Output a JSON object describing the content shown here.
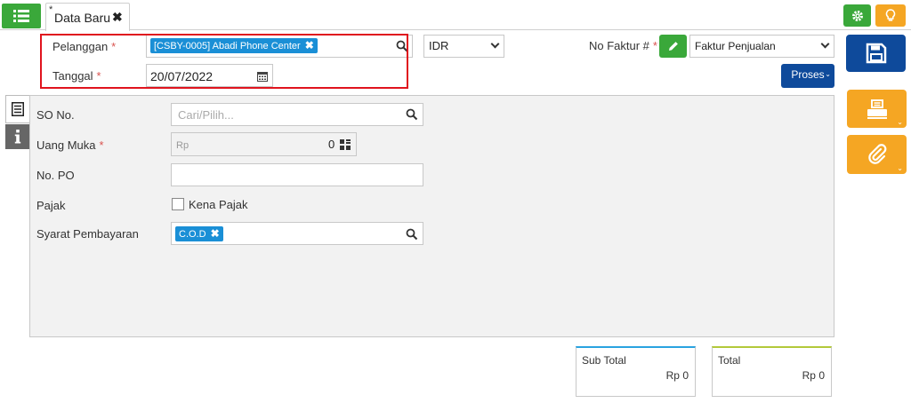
{
  "tab": {
    "modified_mark": "*",
    "title": "Data Baru"
  },
  "header": {
    "pelanggan_label": "Pelanggan",
    "pelanggan_value": "[CSBY-0005] Abadi Phone Center",
    "tanggal_label": "Tanggal",
    "tanggal_value": "20/07/2022",
    "currency": "IDR",
    "no_faktur_label": "No Faktur #",
    "faktur_type": "Faktur Penjualan",
    "proses_label": "Proses",
    "required_mark": "*"
  },
  "side_tabs": [
    {
      "icon": "list-icon"
    },
    {
      "icon": "info-icon"
    }
  ],
  "form": {
    "so_no_label": "SO No.",
    "so_no_placeholder": "Cari/Pilih...",
    "uang_muka_label": "Uang Muka",
    "uang_muka_prefix": "Rp",
    "uang_muka_value": "0",
    "no_po_label": "No. PO",
    "no_po_value": "",
    "pajak_label": "Pajak",
    "kena_pajak_label": "Kena Pajak",
    "kena_pajak_checked": false,
    "syarat_label": "Syarat Pembayaran",
    "syarat_value": "C.O.D"
  },
  "totals": {
    "sub_total_label": "Sub Total",
    "sub_total_value": "Rp 0",
    "total_label": "Total",
    "total_value": "Rp 0"
  },
  "colors": {
    "green": "#3aa83a",
    "orange": "#f5a623",
    "navy": "#0e4a9b",
    "tag_blue": "#1a8fd6",
    "highlight_red": "#e0141e"
  }
}
